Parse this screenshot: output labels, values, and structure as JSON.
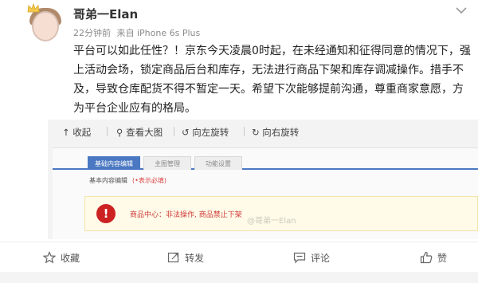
{
  "post": {
    "username": "哥弟一Elan",
    "time_ago": "22分钟前",
    "source": "来自 iPhone 6s Plus",
    "text_lines": [
      "平台可以如此任性？！京东今天凌晨0时起，在未经通知和征得同意的情况下，强",
      "上活动会场，锁定商品后台和库存，无法进行商品下架和库存调减操作。措手不",
      "及，导致仓库配货不得不暂定一天。希望下次能够提前沟通，尊重商家意愿，方",
      "为平台企业应有的格局。"
    ]
  },
  "image_toolbar": {
    "collapse": "收起",
    "view_large": "查看大图",
    "rotate_left": "向左旋转",
    "rotate_right": "向右旋转"
  },
  "embedded_screen": {
    "tabs": [
      "基础内容编辑",
      "主图管理",
      "功能设置"
    ],
    "section_title": "基本内容编辑",
    "section_hint": "(•表示必填)",
    "alert_text": "商品中心：非法操作, 商品禁止下架",
    "watermark": "@哥弟一Elan"
  },
  "actions": {
    "favorite": "收藏",
    "repost": "转发",
    "comment": "评论",
    "like": "赞"
  },
  "colors": {
    "tab_active": "#4a78c2",
    "alert_red": "#cc2222",
    "alert_bg": "#fffbe8"
  }
}
